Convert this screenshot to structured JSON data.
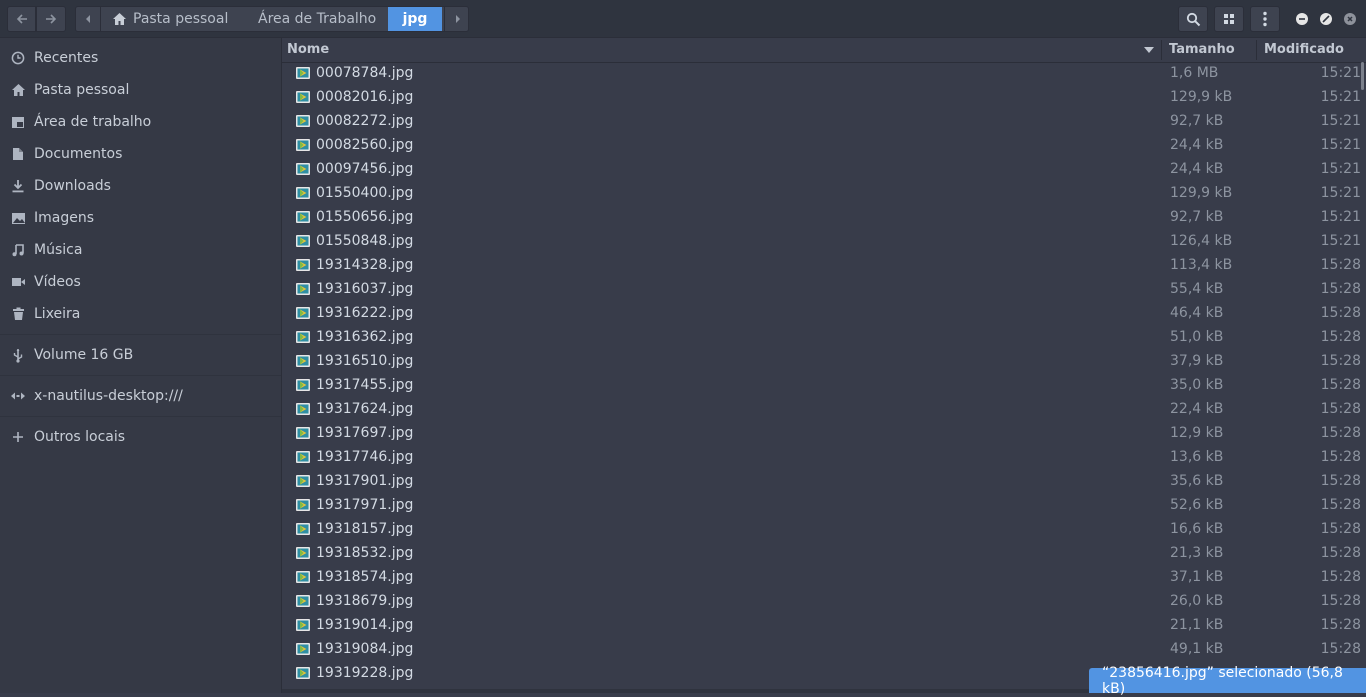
{
  "header": {
    "breadcrumbs": [
      "Pasta pessoal",
      "Área de Trabalho",
      "jpg"
    ]
  },
  "sidebar": {
    "items": [
      {
        "label": "Recentes",
        "icon": "clock-icon"
      },
      {
        "label": "Pasta pessoal",
        "icon": "home-icon"
      },
      {
        "label": "Área de trabalho",
        "icon": "desktop-icon"
      },
      {
        "label": "Documentos",
        "icon": "document-icon"
      },
      {
        "label": "Downloads",
        "icon": "download-icon"
      },
      {
        "label": "Imagens",
        "icon": "image-icon"
      },
      {
        "label": "Música",
        "icon": "music-icon"
      },
      {
        "label": "Vídeos",
        "icon": "video-icon"
      },
      {
        "label": "Lixeira",
        "icon": "trash-icon"
      }
    ],
    "devices": [
      {
        "label": "Volume 16 GB",
        "icon": "usb-icon"
      }
    ],
    "network": [
      {
        "label": "x-nautilus-desktop:///",
        "icon": "network-icon"
      }
    ],
    "other": {
      "label": "Outros locais",
      "icon": "plus-icon"
    }
  },
  "columns": {
    "name": "Nome",
    "size": "Tamanho",
    "modified": "Modificado"
  },
  "files": [
    {
      "name": "00078784.jpg",
      "size": "1,6 MB",
      "modified": "15:21"
    },
    {
      "name": "00082016.jpg",
      "size": "129,9 kB",
      "modified": "15:21"
    },
    {
      "name": "00082272.jpg",
      "size": "92,7 kB",
      "modified": "15:21"
    },
    {
      "name": "00082560.jpg",
      "size": "24,4 kB",
      "modified": "15:21"
    },
    {
      "name": "00097456.jpg",
      "size": "24,4 kB",
      "modified": "15:21"
    },
    {
      "name": "01550400.jpg",
      "size": "129,9 kB",
      "modified": "15:21"
    },
    {
      "name": "01550656.jpg",
      "size": "92,7 kB",
      "modified": "15:21"
    },
    {
      "name": "01550848.jpg",
      "size": "126,4 kB",
      "modified": "15:21"
    },
    {
      "name": "19314328.jpg",
      "size": "113,4 kB",
      "modified": "15:28"
    },
    {
      "name": "19316037.jpg",
      "size": "55,4 kB",
      "modified": "15:28"
    },
    {
      "name": "19316222.jpg",
      "size": "46,4 kB",
      "modified": "15:28"
    },
    {
      "name": "19316362.jpg",
      "size": "51,0 kB",
      "modified": "15:28"
    },
    {
      "name": "19316510.jpg",
      "size": "37,9 kB",
      "modified": "15:28"
    },
    {
      "name": "19317455.jpg",
      "size": "35,0 kB",
      "modified": "15:28"
    },
    {
      "name": "19317624.jpg",
      "size": "22,4 kB",
      "modified": "15:28"
    },
    {
      "name": "19317697.jpg",
      "size": "12,9 kB",
      "modified": "15:28"
    },
    {
      "name": "19317746.jpg",
      "size": "13,6 kB",
      "modified": "15:28"
    },
    {
      "name": "19317901.jpg",
      "size": "35,6 kB",
      "modified": "15:28"
    },
    {
      "name": "19317971.jpg",
      "size": "52,6 kB",
      "modified": "15:28"
    },
    {
      "name": "19318157.jpg",
      "size": "16,6 kB",
      "modified": "15:28"
    },
    {
      "name": "19318532.jpg",
      "size": "21,3 kB",
      "modified": "15:28"
    },
    {
      "name": "19318574.jpg",
      "size": "37,1 kB",
      "modified": "15:28"
    },
    {
      "name": "19318679.jpg",
      "size": "26,0 kB",
      "modified": "15:28"
    },
    {
      "name": "19319014.jpg",
      "size": "21,1 kB",
      "modified": "15:28"
    },
    {
      "name": "19319084.jpg",
      "size": "49,1 kB",
      "modified": "15:28"
    },
    {
      "name": "19319228.jpg",
      "size": "",
      "modified": ""
    }
  ],
  "status": "“23856416.jpg” selecionado  (56,8 kB)",
  "colors": {
    "accent": "#5294e2",
    "background": "#383c4a",
    "sidebar": "#353945",
    "headerbar": "#2f343f"
  }
}
